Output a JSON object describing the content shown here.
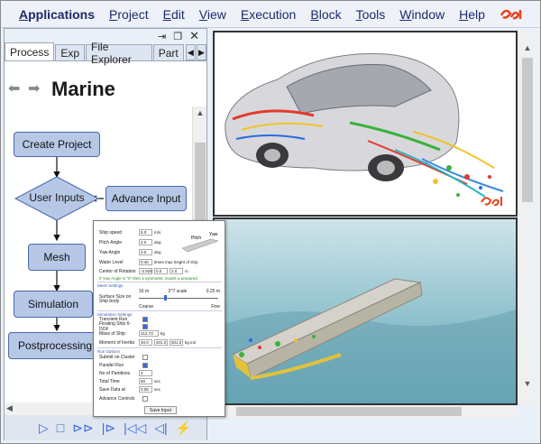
{
  "menu": {
    "items": [
      {
        "label": "Applications",
        "underline": "A",
        "rest": "pplications",
        "bold": true
      },
      {
        "label": "Project",
        "underline": "P",
        "rest": "roject",
        "bold": false
      },
      {
        "label": "Edit",
        "underline": "E",
        "rest": "dit",
        "bold": false
      },
      {
        "label": "View",
        "underline": "V",
        "rest": "iew",
        "bold": false
      },
      {
        "label": "Execution",
        "underline": "E",
        "rest": "xecution",
        "bold": false
      },
      {
        "label": "Block",
        "underline": "B",
        "rest": "lock",
        "bold": false
      },
      {
        "label": "Tools",
        "underline": "T",
        "rest": "ools",
        "bold": false
      },
      {
        "label": "Window",
        "underline": "W",
        "rest": "indow",
        "bold": false
      },
      {
        "label": "Help",
        "underline": "H",
        "rest": "elp",
        "bold": false
      }
    ],
    "logo": "esi"
  },
  "left_panel": {
    "tabs": [
      "Process",
      "Exp",
      "File Explorer",
      "Part"
    ],
    "active_tab": "Process",
    "title": "Marine",
    "flow": {
      "create_project": "Create Project",
      "user_inputs": "User Inputs",
      "advance_input": "Advance Input",
      "mesh": "Mesh",
      "simulation": "Simulation",
      "postprocessing": "Postprocessing"
    }
  },
  "dialog": {
    "ship_speed": {
      "label": "Ship speed",
      "value": "5.0",
      "unit": "m/s"
    },
    "pitch_angle": {
      "label": "Pitch Angle",
      "value": "2.0",
      "unit": "deg"
    },
    "yaw_angle": {
      "label": "Yaw Angle",
      "value": "0.0",
      "unit": "deg"
    },
    "water_level": {
      "label": "Water Level",
      "value": "0.45",
      "unit": "times max height of ship"
    },
    "center_rotation": {
      "label": "Center of Rotation",
      "values": [
        "-2.929",
        "0.0",
        "2.0"
      ],
      "unit": "m"
    },
    "note": "If Yaw Angle is \"0\" then a symmetric model is prepared",
    "mesh_settings": "Mesh Settings",
    "mesh_scale": {
      "left": "16 m",
      "mid": "2^7 scale",
      "right": "0.25 m"
    },
    "surface_size": {
      "label": "Surface Size on Ship body",
      "coarse": "Coarse",
      "fine": "Fine"
    },
    "simulation_settings": "Simulation Settings",
    "transient_run": "Transient Run",
    "floating_ship": "Floating Ship 6-DOF",
    "mass_of_ship": {
      "label": "Mass of Ship",
      "value": "412.73",
      "unit": "kg"
    },
    "moment_inertia": {
      "label": "Moment of Inertia",
      "values": [
        "40.0",
        "401.0",
        "501.0"
      ],
      "unit": "kg.m2"
    },
    "run_options": "Run Options",
    "submit_cluster": "Submit on Cluster",
    "parallel_run": "Parallel Run",
    "partitions": {
      "label": "No of Partitions",
      "value": "2"
    },
    "total_time": {
      "label": "Total Time",
      "value": "50",
      "unit": "sec"
    },
    "save_data": {
      "label": "Save Data at",
      "value": "0.05",
      "unit": "sec"
    },
    "advance_controls": "Advance Controls",
    "save_button": "Save Input",
    "diagram_pitch": "Pitch",
    "diagram_yaw": "Yaw"
  }
}
